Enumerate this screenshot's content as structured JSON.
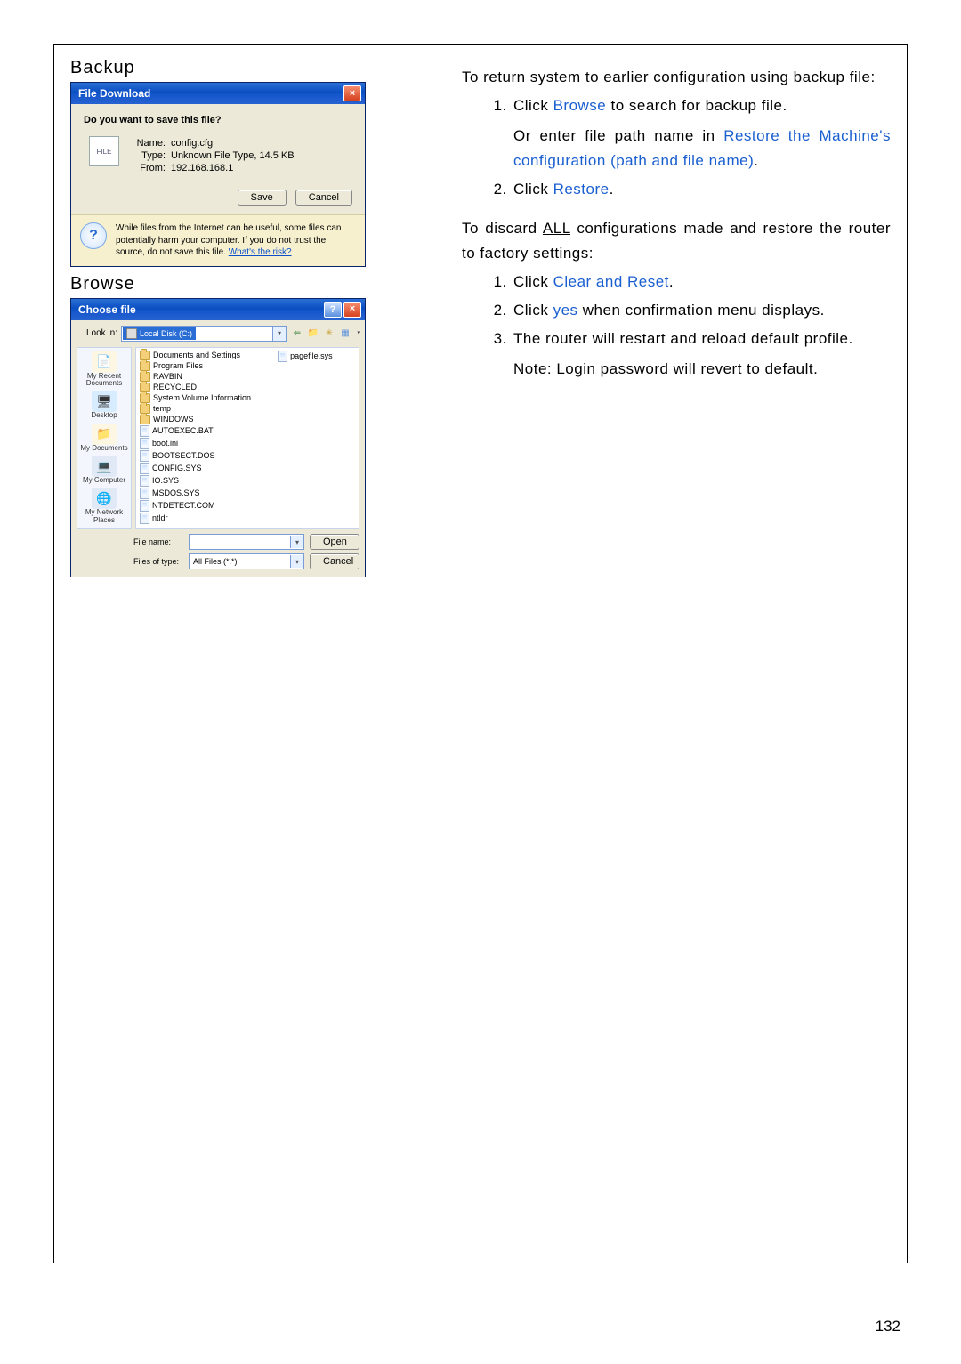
{
  "page_number": "132",
  "left": {
    "backup_heading": "Backup",
    "browse_heading": "Browse",
    "file_download": {
      "title": "File Download",
      "question": "Do you want to save this file?",
      "name_label": "Name:",
      "name_value": "config.cfg",
      "type_label": "Type:",
      "type_value": "Unknown File Type, 14.5 KB",
      "from_label": "From:",
      "from_value": "192.168.168.1",
      "save": "Save",
      "cancel": "Cancel",
      "warning": "While files from the Internet can be useful, some files can potentially harm your computer. If you do not trust the source, do not save this file. ",
      "risk_link": "What's the risk?"
    },
    "choose_file": {
      "title": "Choose file",
      "look_in_label": "Look in:",
      "look_in_value": "Local Disk (C:)",
      "files_col1": [
        "Documents and Settings",
        "Program Files",
        "RAVBIN",
        "RECYCLED",
        "System Volume Information",
        "temp",
        "WINDOWS",
        "AUTOEXEC.BAT",
        "boot.ini",
        "BOOTSECT.DOS",
        "CONFIG.SYS",
        "IO.SYS",
        "MSDOS.SYS",
        "NTDETECT.COM",
        "ntldr"
      ],
      "files_col2": [
        "pagefile.sys"
      ],
      "places": [
        "My Recent Documents",
        "Desktop",
        "My Documents",
        "My Computer",
        "My Network Places"
      ],
      "file_name_label": "File name:",
      "file_name_value": "",
      "file_type_label": "Files of type:",
      "file_type_value": "All Files (*.*)",
      "open": "Open",
      "cancel": "Cancel"
    }
  },
  "right": {
    "intro1": "To return system to earlier configuration using backup file:",
    "list1": {
      "i1a": "Click ",
      "i1_browse": "Browse",
      "i1b": " to search for backup file.",
      "i1c": "Or enter file path name in ",
      "i1_restore_path": "Restore the Machine's configuration (path and file name)",
      "i1d": ".",
      "i2a": "Click ",
      "i2_restore": "Restore",
      "i2b": "."
    },
    "intro2a": "To discard ",
    "intro2_all": "ALL",
    "intro2b": " configurations made and restore the router to factory settings:",
    "list2": {
      "i1a": "Click ",
      "i1_clear": "Clear and Reset",
      "i1b": ".",
      "i2a": "Click ",
      "i2_yes": "yes",
      "i2b": " when confirmation menu displays.",
      "i3": "The router will restart and reload default profile.",
      "note": "Note: Login password will revert to default."
    }
  }
}
